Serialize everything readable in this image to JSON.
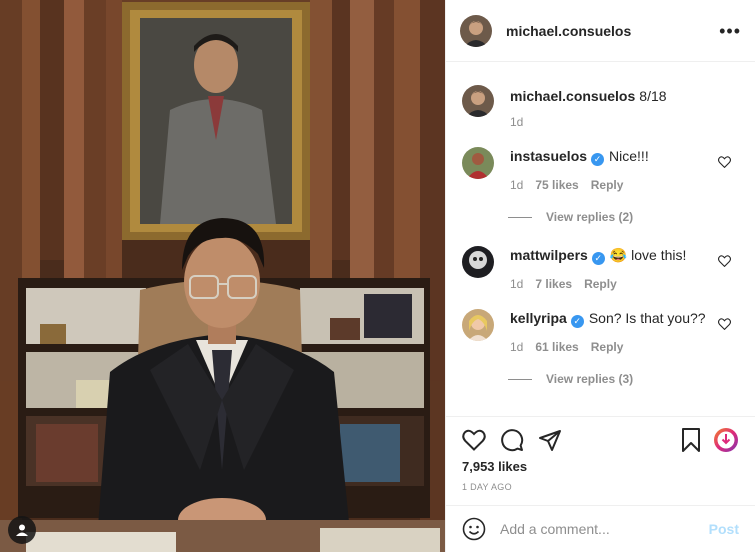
{
  "header": {
    "username": "michael.consuelos",
    "more_icon": "more-icon"
  },
  "caption": {
    "username": "michael.consuelos",
    "text": "8/18",
    "time": "1d"
  },
  "comments": [
    {
      "username": "instasuelos",
      "verified": true,
      "text": "Nice!!!",
      "time": "1d",
      "likes": "75 likes",
      "reply": "Reply",
      "view_replies": "View replies (2)"
    },
    {
      "username": "mattwilpers",
      "verified": true,
      "text": "😂 love this!",
      "time": "1d",
      "likes": "7 likes",
      "reply": "Reply",
      "view_replies": ""
    },
    {
      "username": "kellyripa",
      "verified": true,
      "text": "Son? Is that you??",
      "time": "1d",
      "likes": "61 likes",
      "reply": "Reply",
      "view_replies": "View replies (3)"
    }
  ],
  "post": {
    "likes": "7,953 likes",
    "date": "1 DAY AGO"
  },
  "add_comment": {
    "placeholder": "Add a comment...",
    "post_label": "Post"
  },
  "colors": {
    "verified": "#3897f0",
    "post_button": "#b2dffc",
    "muted": "#8e8e8e"
  }
}
